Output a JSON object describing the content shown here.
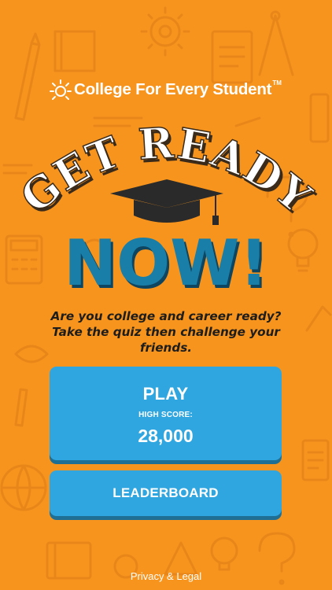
{
  "brand": {
    "logo_text": "College For Every Student",
    "trademark": "TM",
    "logo_icon": "sun-icon"
  },
  "hero": {
    "get_ready_text": "GET READY",
    "now_text": "NOW!",
    "cap_icon": "graduation-cap-icon"
  },
  "tagline": {
    "line1": "Are you college and career ready?",
    "line2": "Take the quiz then challenge your",
    "line3": "friends."
  },
  "play_button": {
    "label": "PLAY",
    "high_score_label": "HIGH SCORE:",
    "high_score_value": "28,000"
  },
  "leaderboard_button": {
    "label": "LEADERBOARD"
  },
  "footer": {
    "privacy_link": "Privacy & Legal"
  },
  "colors": {
    "background": "#f7941d",
    "button": "#2fa6df",
    "button_shadow": "#1f6f95",
    "now_text": "#1a7fa8",
    "get_ready_text": "#ffffff"
  },
  "background_icons": [
    "pencil-icon",
    "gear-icon",
    "calculator-icon",
    "lightbulb-icon",
    "question-mark-icon",
    "book-icon",
    "compass-icon",
    "document-icon",
    "globe-icon",
    "clipboard-icon"
  ]
}
